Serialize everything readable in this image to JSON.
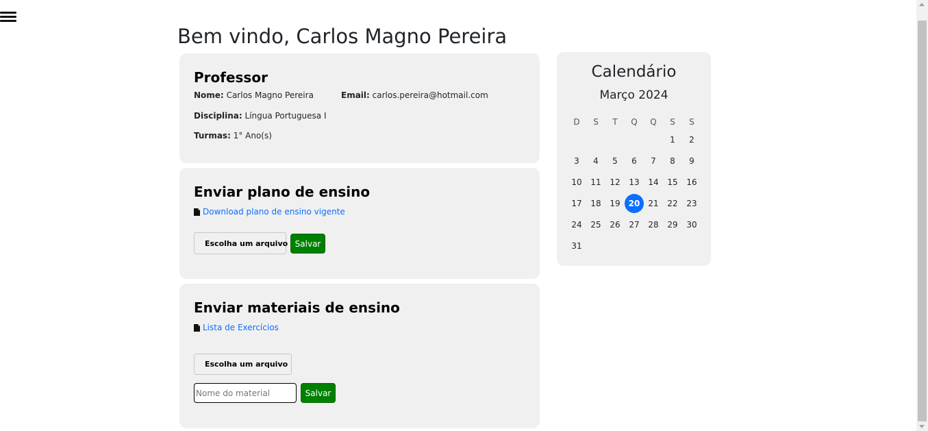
{
  "header": {
    "menu_icon": "hamburger-menu-icon",
    "welcome": "Bem vindo, Carlos Magno Pereira"
  },
  "professor": {
    "title": "Professor",
    "nome_label": "Nome:",
    "nome_value": "Carlos Magno Pereira",
    "email_label": "Email:",
    "email_value": "carlos.pereira@hotmail.com",
    "disciplina_label": "Disciplina:",
    "disciplina_value": "Língua Portuguesa I",
    "turmas_label": "Turmas:",
    "turmas_value": "1° Ano(s)"
  },
  "plano": {
    "title": "Enviar plano de ensino",
    "link_text": "Download plano de ensino vigente",
    "file_icon": "file-icon",
    "choose_label": "Escolha um arquivo",
    "upload_icon": "cloud-upload-icon",
    "save_label": "Salvar"
  },
  "materiais": {
    "title": "Enviar materiais de ensino",
    "link_text": "Lista de Exercícios",
    "file_icon": "file-icon",
    "choose_label": "Escolha um arquivo",
    "upload_icon": "cloud-upload-icon",
    "name_placeholder": "Nome do material",
    "name_value": "",
    "save_label": "Salvar"
  },
  "calendar": {
    "title": "Calendário",
    "month": "Março 2024",
    "weekdays": [
      "D",
      "S",
      "T",
      "Q",
      "Q",
      "S",
      "S"
    ],
    "first_weekday_index": 5,
    "days_in_month": 31,
    "today": 20,
    "today_color": "#0d6efd"
  },
  "colors": {
    "card_bg": "#f0f0f0",
    "link": "#0d6efd",
    "save_button": "#008000"
  }
}
